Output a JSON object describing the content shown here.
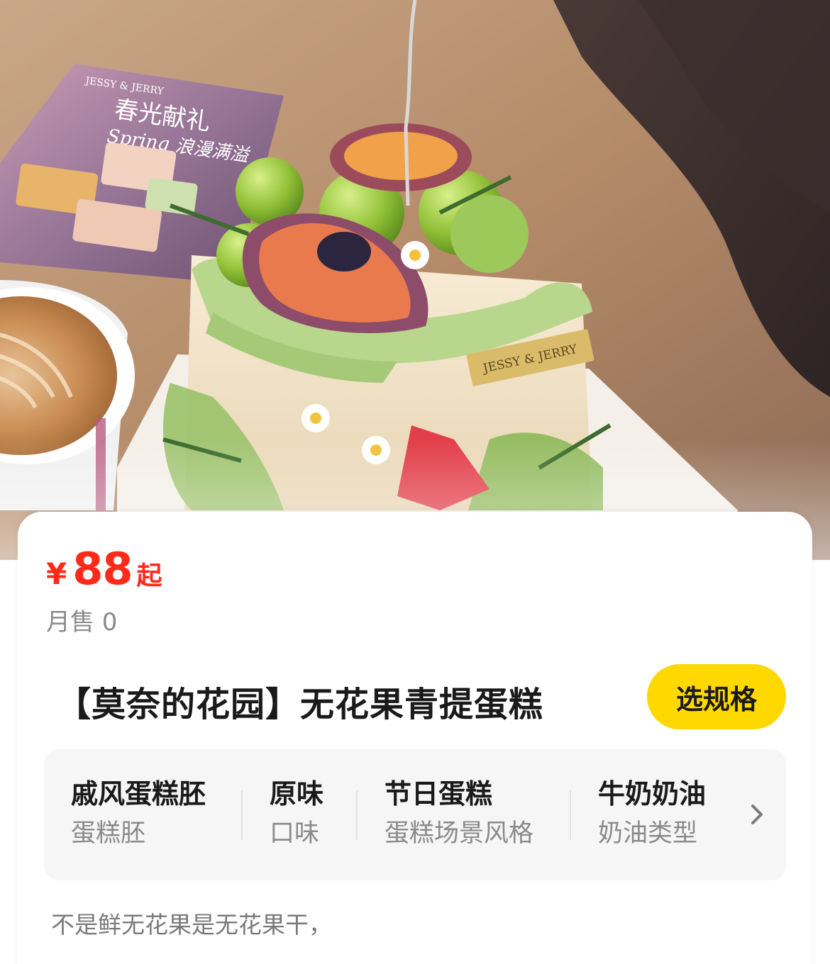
{
  "hero": {
    "image": "fig-green-grape-cake-photo",
    "topper_text": "JESSY & JERRY",
    "flyer_brand": "JESSY & JERRY",
    "flyer_headline": "春光献礼",
    "flyer_subline": "Spring 浪漫满溢"
  },
  "product": {
    "price_symbol": "¥",
    "price_value": "88",
    "price_suffix": "起",
    "monthly_sales": "月售 0",
    "title": "【莫奈的花园】无花果青提蛋糕",
    "select_spec_label": "选规格",
    "attributes": [
      {
        "value": "戚风蛋糕胚",
        "label": "蛋糕胚"
      },
      {
        "value": "原味",
        "label": "口味"
      },
      {
        "value": "节日蛋糕",
        "label": "蛋糕场景风格"
      },
      {
        "value": "牛奶奶油",
        "label": "奶油类型"
      }
    ],
    "more_icon": "chevron-right-icon",
    "description": "不是鲜无花果是无花果干，"
  },
  "colors": {
    "price_red": "#ff2a1a",
    "button_yellow": "#ffd800",
    "panel_bg": "#f6f6f6",
    "muted_text": "#8a8a8a"
  }
}
